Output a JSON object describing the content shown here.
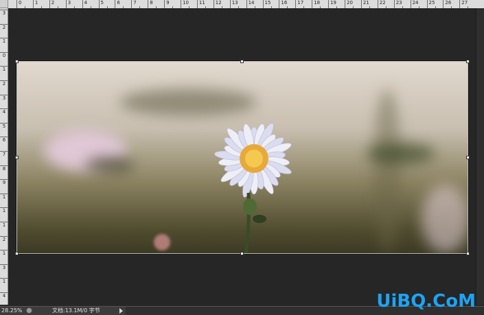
{
  "ruler": {
    "top_numbers": [
      "0",
      "1",
      "2",
      "3",
      "4",
      "5",
      "6",
      "7",
      "8",
      "9",
      "10",
      "11",
      "12",
      "13",
      "14",
      "15",
      "16",
      "17",
      "18",
      "19",
      "20",
      "21",
      "22",
      "23",
      "24",
      "25",
      "26",
      "27"
    ],
    "left_numbers": [
      "3",
      "2",
      "1",
      "0",
      "1",
      "2",
      "3",
      "4",
      "5",
      "6",
      "7",
      "8",
      "9",
      "1",
      "1",
      "1",
      "2",
      "1",
      "3",
      "1",
      "4"
    ]
  },
  "status_bar": {
    "zoom": "28.25%",
    "doc_info": "文档:13.1M/0 字节"
  },
  "watermark": "UiBQ.CoM",
  "colors": {
    "canvas_bg": "#262626",
    "ruler_bg": "#dcdcdc",
    "watermark": "#1ea3f2"
  }
}
